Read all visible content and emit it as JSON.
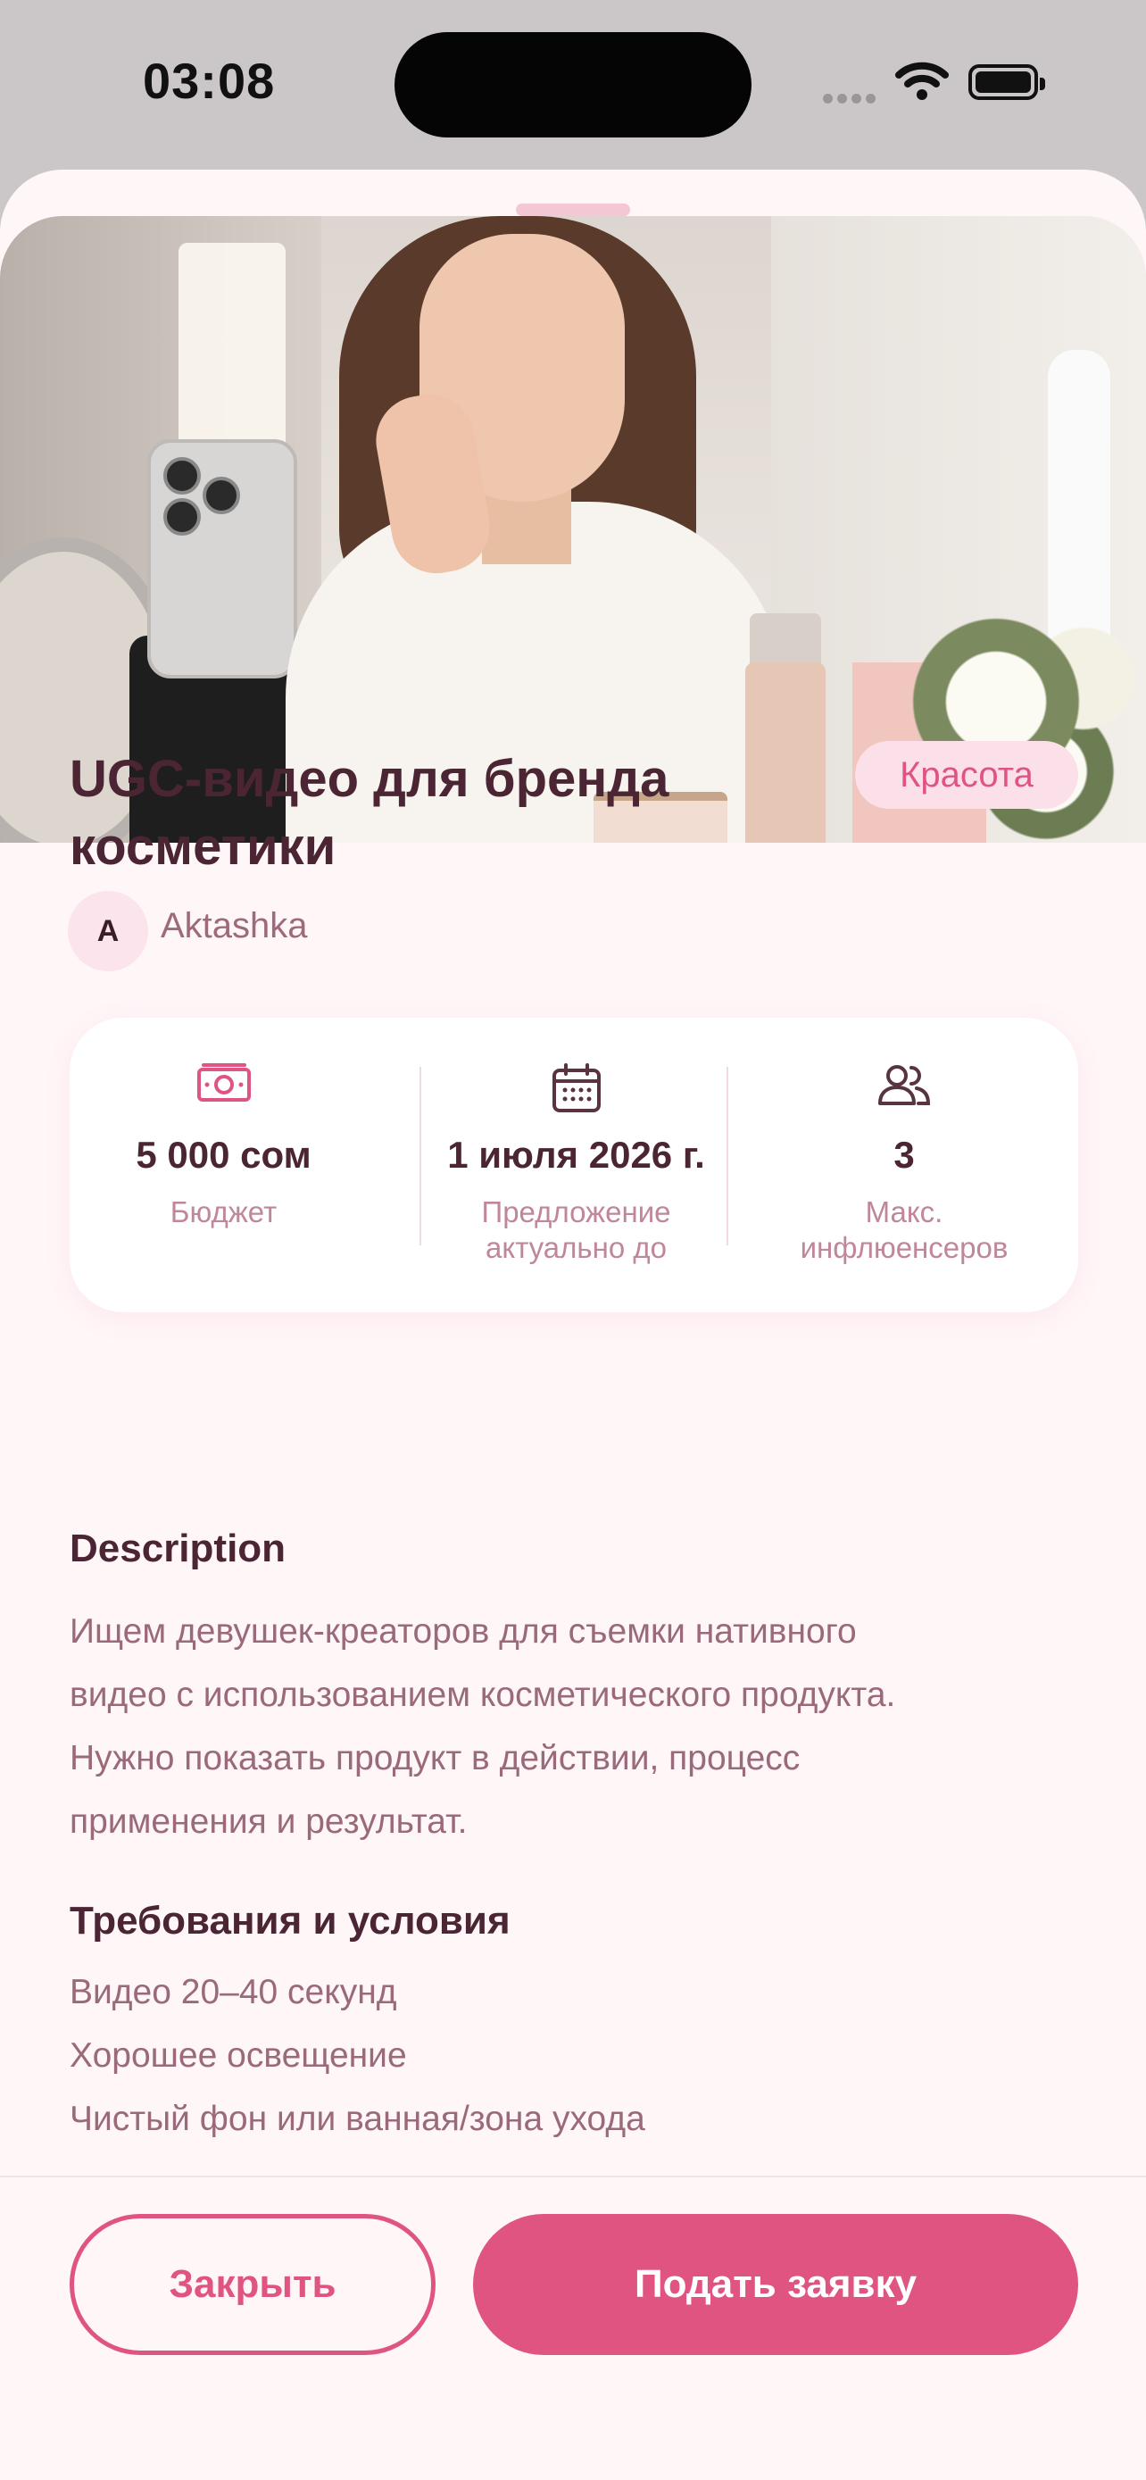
{
  "status_bar": {
    "time": "03:08"
  },
  "colors": {
    "accent": "#df5480",
    "title": "#4b2533",
    "muted": "#9a6a7b",
    "sheet_bg": "#fff6f8",
    "tag_bg": "#fbe0e9"
  },
  "offer": {
    "title": "UGC-видео для бренда косметики",
    "category": "Красота",
    "author_initial": "A",
    "author": "Aktashka",
    "hero_icon": "woman-applying-cosmetics-photo"
  },
  "stats": [
    {
      "icon": "money-icon",
      "value": "5 000 сом",
      "label": "Бюджет"
    },
    {
      "icon": "calendar-icon",
      "value": "1 июля 2026 г.",
      "label_line1": "Предложение",
      "label_line2": "актуально до"
    },
    {
      "icon": "users-icon",
      "value": "3",
      "label_line1": "Макс.",
      "label_line2": "инфлюенсеров"
    }
  ],
  "description": {
    "heading": "Description",
    "lines": [
      "Ищем девушек-креаторов для съемки нативного",
      "видео с использованием косметического продукта.",
      "Нужно показать продукт в действии, процесс",
      "применения и результат."
    ]
  },
  "requirements": {
    "heading": "Требования и условия",
    "items": [
      "Видео 20–40 секунд",
      "Хорошее освещение",
      "Чистый фон или ванная/зона ухода"
    ]
  },
  "actions": {
    "close_label": "Закрыть",
    "apply_label": "Подать заявку"
  }
}
